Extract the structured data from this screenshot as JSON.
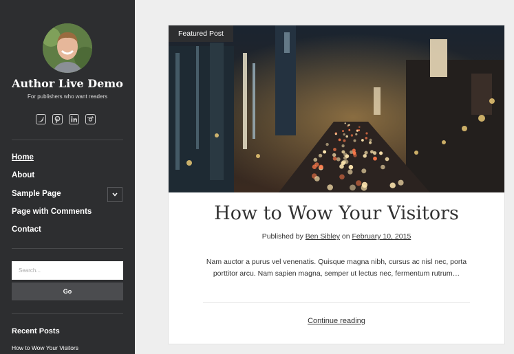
{
  "site": {
    "title": "Author Live Demo",
    "tagline": "For publishers who want readers"
  },
  "social": [
    "twitter-icon",
    "pinterest-icon",
    "linkedin-icon",
    "instagram-icon"
  ],
  "nav": {
    "items": [
      {
        "label": "Home"
      },
      {
        "label": "About"
      },
      {
        "label": "Sample Page"
      },
      {
        "label": "Page with Comments"
      },
      {
        "label": "Contact"
      }
    ]
  },
  "search": {
    "placeholder": "Search...",
    "button_label": "Go"
  },
  "recent": {
    "heading": "Recent Posts",
    "items": [
      "How to Wow Your Visitors"
    ]
  },
  "post": {
    "badge": "Featured Post",
    "title": "How to Wow Your Visitors",
    "byline_prefix": "Published by",
    "author": "Ben Sibley",
    "byline_mid": "on",
    "date": "February 10, 2015",
    "excerpt": "Nam auctor a purus vel venenatis. Quisque magna nibh, cursus ac nisl nec, porta porttitor arcu. Nam sapien magna, semper ut lectus nec, fermentum rutrum…",
    "continue_label": "Continue reading"
  },
  "colors": {
    "sidebar_bg": "#2d2e30",
    "page_bg": "#eeeeee"
  }
}
